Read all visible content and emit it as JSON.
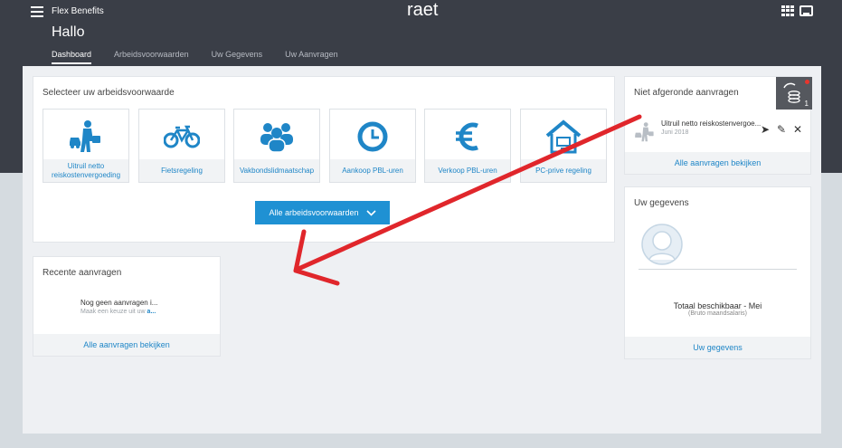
{
  "header": {
    "app_name": "Flex Benefits",
    "logo": "raet",
    "greeting": "Hallo",
    "tabs": [
      {
        "label": "Dashboard",
        "active": true
      },
      {
        "label": "Arbeidsvoorwaarden",
        "active": false
      },
      {
        "label": "Uw Gegevens",
        "active": false
      },
      {
        "label": "Uw Aanvragen",
        "active": false
      }
    ],
    "icons": [
      "menu-icon",
      "apps-grid-icon",
      "inbox-icon"
    ]
  },
  "select_card": {
    "title": "Selecteer uw arbeidsvoorwaarde",
    "tiles": [
      {
        "label": "Uitruil netto reiskostenvergoeding",
        "icon": "commuter-icon"
      },
      {
        "label": "Fietsregeling",
        "icon": "bicycle-icon"
      },
      {
        "label": "Vakbondslidmaatschap",
        "icon": "group-icon"
      },
      {
        "label": "Aankoop PBL-uren",
        "icon": "clock-icon"
      },
      {
        "label": "Verkoop PBL-uren",
        "icon": "euro-icon"
      },
      {
        "label": "PC-prive regeling",
        "icon": "home-computer-icon"
      }
    ],
    "all_button": "Alle arbeidsvoorwaarden"
  },
  "recent_card": {
    "title": "Recente aanvragen",
    "empty_main": "Nog geen aanvragen i...",
    "empty_sub_prefix": "Maak een keuze uit uw ",
    "empty_sub_link": "a...",
    "footer_link": "Alle aanvragen bekijken"
  },
  "pending_card": {
    "title": "Niet afgeronde aanvragen",
    "badge_count": "1",
    "request": {
      "title": "Uitruil netto reiskostenvergoe...",
      "date": "Juni 2018"
    },
    "footer_link": "Alle aanvragen bekijken"
  },
  "profile_card": {
    "title": "Uw gegevens",
    "total_label": "Totaal beschikbaar - Mei",
    "total_sub": "(Bruto maandsalaris)",
    "footer_link": "Uw gegevens"
  },
  "colors": {
    "header_bg": "#3a3e47",
    "accent": "#1f91d3",
    "annotation_arrow": "#e0262b"
  }
}
